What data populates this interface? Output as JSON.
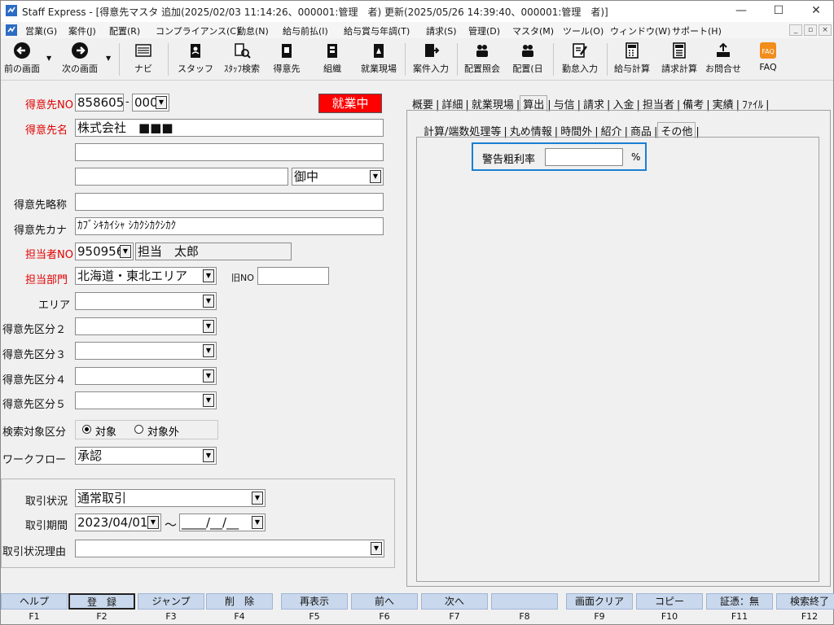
{
  "window": {
    "title": "Staff Express - [得意先マスタ 追加(2025/02/03 11:14:26、000001:管理　者) 更新(2025/05/26 14:39:40、000001:管理　者)]"
  },
  "menu": [
    "営業(G)",
    "案件(J)",
    "配置(R)",
    "コンプライアンス(C)",
    "勤怠(N)",
    "給与前払(I)",
    "給与賞与年調(T)",
    "請求(S)",
    "管理(D)",
    "マスタ(M)",
    "ツール(O)",
    "ウィンドウ(W)",
    "サポート(H)"
  ],
  "toolbar": {
    "prev": "前の画面",
    "next": "次の画面",
    "navi": "ナビ",
    "staff": "スタッフ",
    "staff_search": "ｽﾀｯﾌ検索",
    "customer": "得意先",
    "org": "組織",
    "worksite": "就業現場",
    "case_input": "案件入力",
    "assign_inquiry": "配置照会",
    "assign_day": "配置(日",
    "attendance": "勤怠入力",
    "payroll": "給与計算",
    "billing": "請求計算",
    "notice": "お問合せ",
    "faq": "FAQ"
  },
  "form": {
    "customer_no_label": "得意先NO",
    "customer_no": "858605",
    "customer_no_sep": "-",
    "customer_branch": "000",
    "status_badge": "就業中",
    "customer_name_label": "得意先名",
    "customer_name": "株式会社　■■■",
    "addr2": "",
    "addr3": "",
    "honorific": "御中",
    "short_name_label": "得意先略称",
    "short_name": "",
    "kana_label": "得意先カナ",
    "kana": "ｶﾌﾞｼｷｶｲｼｬ ｼｶｸｼｶｸｼｶｸ",
    "rep_no_label": "担当者NO",
    "rep_no": "950956",
    "rep_name": "担当　太郎",
    "dept_label": "担当部門",
    "dept": "北海道・東北エリア",
    "old_no_label": "旧NO",
    "old_no": "",
    "area_label": "エリア",
    "area": "",
    "class2_label": "得意先区分２",
    "class3_label": "得意先区分３",
    "class4_label": "得意先区分４",
    "class5_label": "得意先区分５",
    "search_label": "検索対象区分",
    "search_on": "対象",
    "search_off": "対象外",
    "workflow_label": "ワークフロー",
    "workflow": "承認",
    "trade_status_label": "取引状況",
    "trade_status": "通常取引",
    "trade_period_label": "取引期間",
    "trade_from": "2023/04/01",
    "trade_tilde": "～",
    "trade_to": "____/__/__",
    "trade_reason_label": "取引状況理由",
    "trade_reason": ""
  },
  "tabs": [
    "概要",
    "詳細",
    "就業現場",
    "算出",
    "与信",
    "請求",
    "入金",
    "担当者",
    "備考",
    "実績",
    "ﾌｧｲﾙ"
  ],
  "subtabs": [
    "計算/端数処理等",
    "丸め情報",
    "時間外",
    "紹介",
    "商品",
    "その他"
  ],
  "warning": {
    "label": "警告粗利率",
    "value": "",
    "unit": "%"
  },
  "fkeys": [
    {
      "label": "ヘルプ",
      "key": "F1"
    },
    {
      "label": "登　録",
      "key": "F2"
    },
    {
      "label": "ジャンプ",
      "key": "F3"
    },
    {
      "label": "削　除",
      "key": "F4"
    },
    {
      "label": "再表示",
      "key": "F5"
    },
    {
      "label": "前へ",
      "key": "F6"
    },
    {
      "label": "次へ",
      "key": "F7"
    },
    {
      "label": "",
      "key": "F8"
    },
    {
      "label": "画面クリア",
      "key": "F9"
    },
    {
      "label": "コピー",
      "key": "F10"
    },
    {
      "label": "証憑：無",
      "key": "F11"
    },
    {
      "label": "検索終了",
      "key": "F12"
    }
  ],
  "colors": {
    "required_label": "#e00000",
    "status_badge_bg": "#ff0000",
    "focus_border": "#1a7fd4",
    "fkey_bg": "#c9d8ec"
  }
}
